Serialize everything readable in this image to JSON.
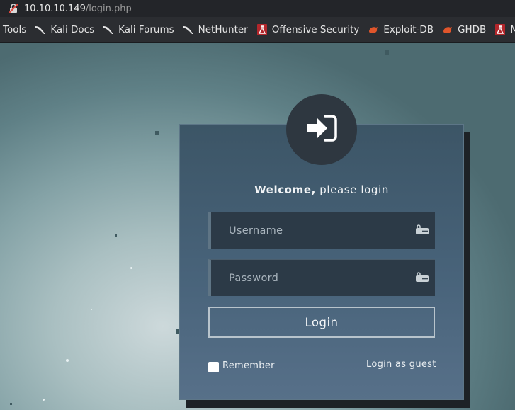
{
  "browser": {
    "url_host": "10.10.10.149",
    "url_path": "/login.php"
  },
  "bookmarks": [
    {
      "label": "i Tools",
      "icon": "kali-dragon-icon"
    },
    {
      "label": "Kali Docs",
      "icon": "kali-dragon-icon"
    },
    {
      "label": "Kali Forums",
      "icon": "kali-dragon-icon"
    },
    {
      "label": "NetHunter",
      "icon": "kali-dragon-icon"
    },
    {
      "label": "Offensive Security",
      "icon": "offsec-icon"
    },
    {
      "label": "Exploit-DB",
      "icon": "exploitdb-icon"
    },
    {
      "label": "GHDB",
      "icon": "exploitdb-icon"
    },
    {
      "label": "MS",
      "icon": "offsec-icon"
    }
  ],
  "login": {
    "icon": "sign-in-icon",
    "welcome_bold": "Welcome,",
    "welcome_rest": " please login",
    "username_placeholder": "Username",
    "password_placeholder": "Password",
    "login_label": "Login",
    "remember_label": "Remember",
    "guest_label": "Login as guest"
  },
  "colors": {
    "card": "#48637a",
    "field": "#2c3a47",
    "avatar": "#2e3740",
    "offsec_red": "#b3262b",
    "exploit_orange": "#e0552b"
  }
}
